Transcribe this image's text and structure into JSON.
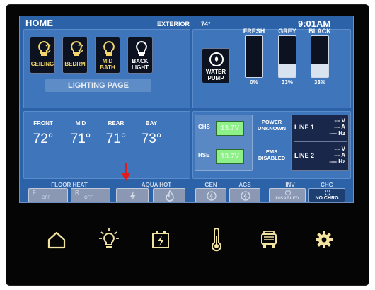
{
  "header": {
    "title": "HOME",
    "exterior_label": "EXTERIOR",
    "exterior_temp": "74°",
    "time": "9:01AM"
  },
  "lighting": {
    "buttons": [
      {
        "line1": "CEILING",
        "line2": ""
      },
      {
        "line1": "BEDRM",
        "line2": ""
      },
      {
        "line1": "MID",
        "line2": "BATH"
      },
      {
        "line1": "BACK",
        "line2": "LIGHT"
      }
    ],
    "page_label": "LIGHTING PAGE"
  },
  "water_pump": {
    "line1": "WATER",
    "line2": "PUMP"
  },
  "tanks": [
    {
      "name": "FRESH",
      "percent_label": "0%",
      "level": 0.0
    },
    {
      "name": "GREY",
      "percent_label": "33%",
      "level": 0.33
    },
    {
      "name": "BLACK",
      "percent_label": "33%",
      "level": 0.33
    }
  ],
  "temps": [
    {
      "name": "FRONT",
      "value": "72°"
    },
    {
      "name": "MID",
      "value": "71°"
    },
    {
      "name": "REAR",
      "value": "71°"
    },
    {
      "name": "BAY",
      "value": "73°"
    }
  ],
  "power": {
    "chs_label": "CHS",
    "chs_value": "13.7V",
    "hse_label": "HSE",
    "hse_value": "13.7V",
    "power_status": "POWER UNKNOWN",
    "ems_status": "EMS DISABLED",
    "line1": {
      "label": "LINE 1",
      "v": "--- V",
      "a": "--- A",
      "hz": "---- Hz"
    },
    "line2": {
      "label": "LINE 2",
      "v": "--- V",
      "a": "--- A",
      "hz": "---- Hz"
    }
  },
  "controls": {
    "sections": {
      "floor_heat": "FLOOR HEAT",
      "aqua_hot": "AQUA HOT",
      "gen": "GEN",
      "ags": "AGS",
      "inv": "INV",
      "chg": "CHG"
    },
    "floor_heat": [
      {
        "label": "F",
        "state": "OFF"
      },
      {
        "label": "R",
        "state": "OFF"
      }
    ],
    "inv_status": "DISABLED",
    "chg_status": "NO CHRG"
  },
  "nav": [
    {
      "icon": "home-icon"
    },
    {
      "icon": "lightbulb-icon"
    },
    {
      "icon": "battery-icon"
    },
    {
      "icon": "thermometer-icon"
    },
    {
      "icon": "generator-icon"
    },
    {
      "icon": "gear-icon"
    }
  ],
  "colors": {
    "screen_bg": "#2c62a8",
    "panel_bg": "#3f75ba",
    "accent_yellow": "#f2d56b",
    "voltage_green": "#8ef088",
    "indicator_red": "#e21b1b"
  }
}
